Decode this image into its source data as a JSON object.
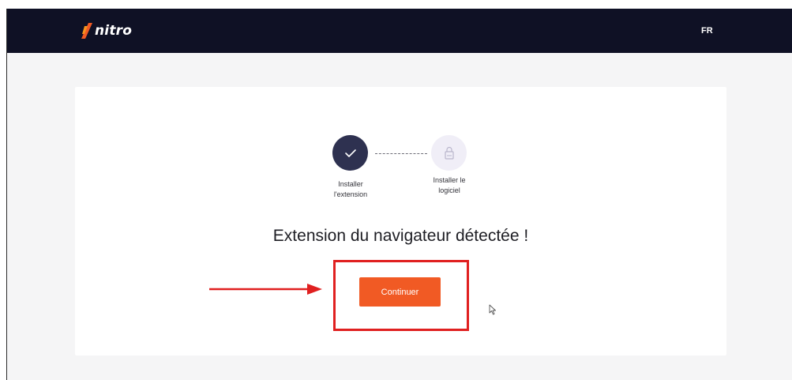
{
  "header": {
    "logo_text": "nitro",
    "language": "FR"
  },
  "steps": [
    {
      "label_line1": "Installer",
      "label_line2": "l'extension",
      "status": "completed",
      "icon": "check-icon"
    },
    {
      "label_line1": "Installer le",
      "label_line2": "logiciel",
      "status": "pending",
      "icon": "lock-icon"
    }
  ],
  "main": {
    "title": "Extension du navigateur détectée !",
    "continue_label": "Continuer"
  },
  "colors": {
    "topbar": "#0f1125",
    "accent": "#f15a24",
    "step_done": "#2e3150",
    "step_pending": "#f0eef7",
    "annotation": "#e02020"
  }
}
